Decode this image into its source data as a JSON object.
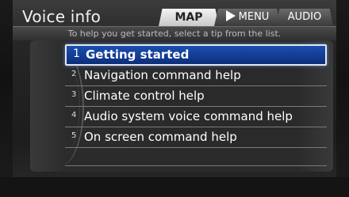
{
  "header": {
    "title": "Voice info",
    "tabs": [
      {
        "label": "MAP"
      },
      {
        "label": "MENU"
      },
      {
        "label": "AUDIO"
      }
    ]
  },
  "hint": "To help you get started, select a tip from the list.",
  "list": {
    "selected_index": 0,
    "items": [
      {
        "num": "1",
        "label": "Getting started"
      },
      {
        "num": "2",
        "label": "Navigation command help"
      },
      {
        "num": "3",
        "label": "Climate control help"
      },
      {
        "num": "4",
        "label": "Audio system voice command help"
      },
      {
        "num": "5",
        "label": "On screen command help"
      }
    ]
  },
  "colors": {
    "selection": "#1a4fb0",
    "background": "#2a2a2a"
  }
}
